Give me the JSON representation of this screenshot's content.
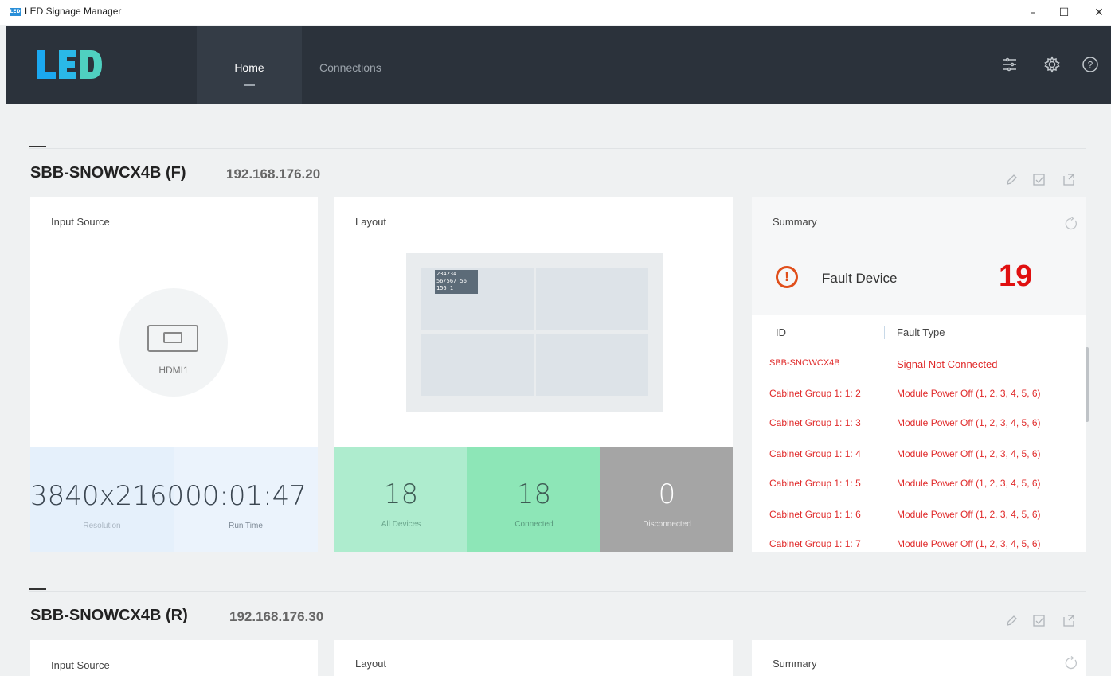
{
  "window": {
    "title": "LED Signage Manager",
    "icon_text": "LED",
    "minimize": "–",
    "maximize": "☐",
    "close": "✕"
  },
  "nav": {
    "logo": "LED",
    "tabs": [
      {
        "label": "Home",
        "active": true
      },
      {
        "label": "Connections",
        "active": false
      }
    ],
    "icons": [
      "sliders-icon",
      "gear-icon",
      "help-icon"
    ]
  },
  "devices": [
    {
      "name": "SBB-SNOWCX4B (F)",
      "ip": "192.168.176.20",
      "actions": [
        "edit-icon",
        "export-icon",
        "share-icon"
      ],
      "input_source": {
        "label": "Input Source",
        "source": "HDMI1",
        "resolution": {
          "value": "3840x2160",
          "label": "Resolution"
        },
        "run_time": {
          "value": "00:01:47",
          "label": "Run Time"
        }
      },
      "layout": {
        "label": "Layout",
        "cell_tag": "234234 56/56/ 56 156 1",
        "all_devices": {
          "value": "18",
          "label": "All Devices"
        },
        "connected": {
          "value": "18",
          "label": "Connected"
        },
        "disconnected": {
          "value": "0",
          "label": "Disconnected"
        }
      },
      "summary": {
        "label": "Summary",
        "fault_label": "Fault Device",
        "fault_count": "19",
        "col_id": "ID",
        "col_type": "Fault Type",
        "rows": [
          {
            "id": "SBB-SNOWCX4B",
            "type": "Signal Not Connected"
          },
          {
            "id": "Cabinet Group 1: 1: 2",
            "type": "Module Power Off (1, 2, 3, 4, 5, 6)"
          },
          {
            "id": "Cabinet Group 1: 1: 3",
            "type": "Module Power Off (1, 2, 3, 4, 5, 6)"
          },
          {
            "id": "Cabinet Group 1: 1: 4",
            "type": "Module Power Off (1, 2, 3, 4, 5, 6)"
          },
          {
            "id": "Cabinet Group 1: 1: 5",
            "type": "Module Power Off (1, 2, 3, 4, 5, 6)"
          },
          {
            "id": "Cabinet Group 1: 1: 6",
            "type": "Module Power Off (1, 2, 3, 4, 5, 6)"
          },
          {
            "id": "Cabinet Group 1: 1: 7",
            "type": "Module Power Off (1, 2, 3, 4, 5, 6)"
          }
        ]
      }
    },
    {
      "name": "SBB-SNOWCX4B (R)",
      "ip": "192.168.176.30",
      "actions": [
        "edit-icon",
        "export-icon",
        "share-icon"
      ],
      "input_source": {
        "label": "Input Source"
      },
      "layout": {
        "label": "Layout"
      },
      "summary": {
        "label": "Summary"
      }
    }
  ],
  "colors": {
    "nav_bg": "#2b323b",
    "fault_red": "#e01010",
    "all_devices_bg": "#aeecce",
    "connected_bg": "#8de6b7",
    "disconnected_bg": "#a5a5a5"
  }
}
